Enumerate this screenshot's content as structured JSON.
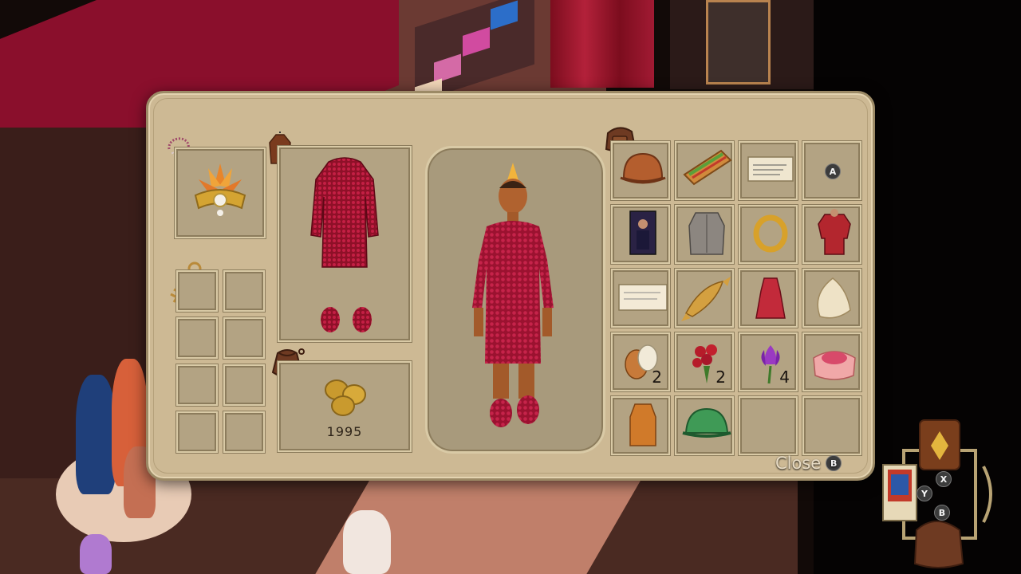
{
  "panel": {
    "equip_accessory": {
      "item": "headdress-icon",
      "badge": "necklace-icon"
    },
    "outfit_slot": {
      "item": "red-sequin-dress",
      "badge": "coat-icon"
    },
    "key_slots": {
      "badge": "key-icon",
      "items": [
        "key-icon",
        "",
        "",
        "",
        "",
        "",
        "",
        ""
      ]
    },
    "money": {
      "badge": "coin-purse-icon",
      "amount": "1995"
    },
    "bag_badge": "backpack-icon",
    "inventory": [
      {
        "icon": "cloche-hat-icon",
        "count": ""
      },
      {
        "icon": "sandwich-icon",
        "count": ""
      },
      {
        "icon": "note-icon",
        "count": ""
      },
      {
        "icon": "empty",
        "count": "",
        "prompt": "A"
      },
      {
        "icon": "portrait-card-icon",
        "count": ""
      },
      {
        "icon": "fur-coat-icon",
        "count": ""
      },
      {
        "icon": "gold-ring-icon",
        "count": ""
      },
      {
        "icon": "red-uniform-icon",
        "count": ""
      },
      {
        "icon": "letter-icon",
        "count": ""
      },
      {
        "icon": "fish-icon",
        "count": ""
      },
      {
        "icon": "red-dress-icon",
        "count": ""
      },
      {
        "icon": "shell-icon",
        "count": ""
      },
      {
        "icon": "egg-icon",
        "count": "2"
      },
      {
        "icon": "rose-bouquet-icon",
        "count": "2"
      },
      {
        "icon": "crocus-flower-icon",
        "count": "4"
      },
      {
        "icon": "cake-icon",
        "count": ""
      },
      {
        "icon": "orange-dress-icon",
        "count": ""
      },
      {
        "icon": "green-helmet-icon",
        "count": ""
      },
      {
        "icon": "empty",
        "count": ""
      },
      {
        "icon": "empty",
        "count": ""
      }
    ],
    "close_label": "Close",
    "close_button": "B"
  },
  "hud": {
    "x_button": "X",
    "y_button": "Y",
    "b_button": "B"
  },
  "colors": {
    "panel": "#cdb994",
    "slot": "#b3a383",
    "dress_red": "#a3142f",
    "gold": "#d4a432"
  }
}
